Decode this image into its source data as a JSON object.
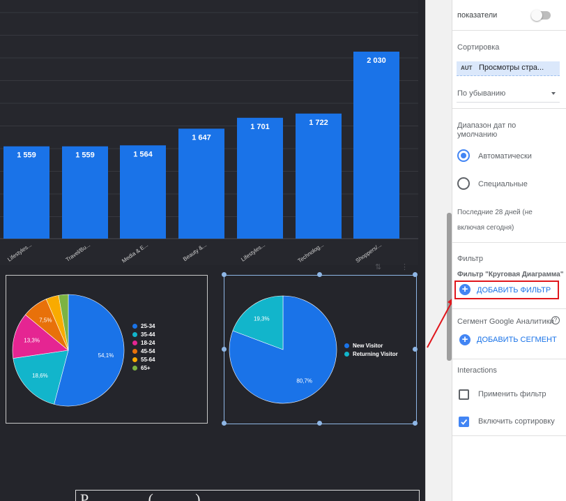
{
  "chart_data": [
    {
      "type": "bar",
      "categories": [
        "Lifestyles...",
        "Travel/Bu...",
        "Media & E...",
        "Beauty &...",
        "Lifestyles...",
        "Technolog...",
        "Shoppers/..."
      ],
      "values": [
        1559,
        1559,
        1564,
        1647,
        1701,
        1722,
        2030
      ],
      "data_labels": [
        "1 559",
        "1 559",
        "1 564",
        "1 647",
        "1 701",
        "1 722",
        "2 030"
      ],
      "color": "#1a73e8",
      "grid": true
    },
    {
      "type": "pie",
      "labels": [
        "25-34",
        "35-44",
        "18-24",
        "45-54",
        "55-64",
        "65+"
      ],
      "values": [
        54.1,
        18.6,
        13.3,
        7.5,
        3.7,
        2.8
      ],
      "data_labels": [
        "54,1%",
        "18,6%",
        "13,3%",
        "7,5%",
        "",
        ""
      ],
      "colors": [
        "#1a73e8",
        "#12b5cb",
        "#e52592",
        "#e8710a",
        "#f9ab00",
        "#7cb342"
      ],
      "legend": "right"
    },
    {
      "type": "pie",
      "labels": [
        "New Visitor",
        "Returning Visitor"
      ],
      "values": [
        80.7,
        19.3
      ],
      "data_labels": [
        "80,7%",
        "19,3%"
      ],
      "colors": [
        "#1a73e8",
        "#12b5cb"
      ],
      "legend": "right"
    }
  ],
  "canvas": {
    "bottom_text": "Р... ... ... ... (... ... ...)"
  },
  "panel": {
    "metrics_label": "показатели",
    "sort": {
      "title": "Сортировка",
      "chip_tag": "AUT",
      "chip_label": "Просмотры стра...",
      "order": "По убыванию"
    },
    "date_range": {
      "title": "Диапазон дат по умолчанию",
      "auto": "Автоматически",
      "custom": "Специальные",
      "note": "Последние 28 дней (не включая сегодня)"
    },
    "filter": {
      "title": "Фильтр",
      "subtitle": "Фильтр \"Круговая Диаграмма\"",
      "add": "ДОБАВИТЬ ФИЛЬТР"
    },
    "segment": {
      "title": "Сегмент Google Аналитики",
      "add": "ДОБАВИТЬ СЕГМЕНТ"
    },
    "interactions": {
      "title": "Interactions",
      "apply_filter": "Применить фильтр",
      "enable_sort": "Включить сортировку"
    }
  },
  "colors": {
    "highlight": "#e0161c",
    "accent": "#4285f4",
    "canvas_bg": "#24252b"
  }
}
